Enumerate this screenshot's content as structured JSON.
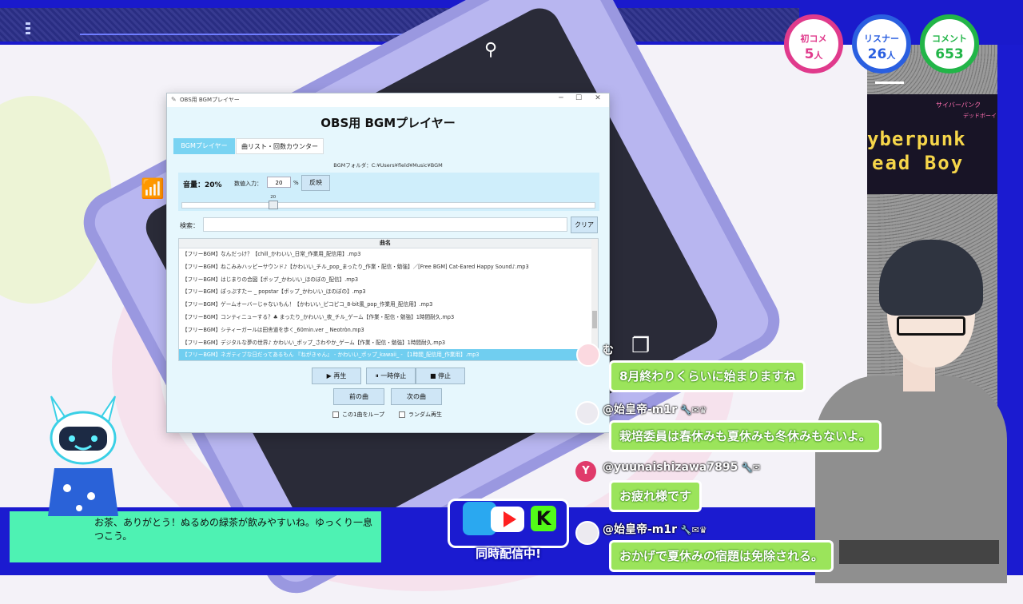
{
  "overlay": {
    "stats": [
      {
        "label": "初コメ",
        "value": "5",
        "unit": "人",
        "color": "#e03a8c"
      },
      {
        "label": "リスナー",
        "value": "26",
        "unit": "人",
        "color": "#2a5fe0"
      },
      {
        "label": "コメント",
        "value": "653",
        "unit": "",
        "color": "#22b548"
      }
    ],
    "thumbnail": {
      "line1": "yberpunk",
      "line2": "ead Boy",
      "jp1": "サイバーパンク",
      "jp2": "デッドボーイ"
    },
    "logo_text": "同時配信中!",
    "icons": [
      "search-icon",
      "wifi-icon",
      "layers-icon"
    ]
  },
  "window": {
    "title": "OBS用 BGMプレイヤー",
    "controls": [
      "─",
      "☐",
      "✕"
    ],
    "heading": "OBS用 BGMプレイヤー",
    "tabs": [
      {
        "label": "BGMプレイヤー",
        "active": true
      },
      {
        "label": "曲リスト・回数カウンター",
        "active": false
      }
    ],
    "folder": "BGMフォルダ：C:¥Users¥field¥Music¥BGM",
    "volume": {
      "label": "音量：20%",
      "input_label": "数値入力：",
      "input_value": "20",
      "unit": "%",
      "apply": "反映",
      "slider_value": "20",
      "slider_level": 0.2
    },
    "search": {
      "label": "検索：",
      "value": "",
      "clear": "クリア"
    },
    "list": {
      "header": "曲名",
      "selected_index": 8,
      "items": [
        "【フリーBGM】なんだっけ？【chill_かわいい_日常_作業用_配信用】.mp3",
        "【フリーBGM】ねこみみハッピーサウンド♪【かわいい_チル_pop_まったり_作業・配信・勉強】／[Free BGM] Cat-Eared Happy Sound♪.mp3",
        "【フリーBGM】はじまりの合図【ポップ_かわいい_ほのぼの_配信】.mp3",
        "【フリーBGM】ぽっぷすたー _ popstar【ポップ_かわいい_ほのぼの】.mp3",
        "【フリーBGM】ゲームオーバーじゃないもん！【かわいい_ピコピコ_8-bit風_pop_作業用_配信用】.mp3",
        "【フリーBGM】コンティニューする？♣ まったり_かわいい_夜_チル_ゲーム【作業・配信・勉強】1時間耐久.mp3",
        "【フリーBGM】シティーガールは田舎道を歩く_60min.ver _ Neotròn.mp3",
        "【フリーBGM】デジタルな夢の世界♪ かわいい_ポップ_さわやか_ゲーム【作業・配信・勉強】1時間耐久.mp3",
        "【フリーBGM】ネガティブな日だってあるもん 『ねがきゃん』 - かわいい_ポップ_kawaii_ - 【1時間_配信用_作業用】.mp3"
      ]
    },
    "buttons": {
      "play": "▶ 再生",
      "pause": "⏸ 一時停止",
      "stop": "■ 停止",
      "prev": "前の曲",
      "next": "次の曲"
    },
    "checkboxes": {
      "loop": "この1曲をループ",
      "random": "ランダム再生"
    }
  },
  "chat": [
    {
      "name": "む",
      "message": "8月終わりくらいに始まりますね",
      "badges": []
    },
    {
      "name": "@始皇帝-m1r",
      "message": "栽培委員は春休みも夏休みも冬休みもないよ。",
      "badges": [
        "wrench-icon",
        "mail-icon",
        "crown-icon"
      ]
    },
    {
      "name": "@yuunaishizawa7895",
      "message": "お疲れ様です",
      "badges": [
        "wrench-icon",
        "mail-icon"
      ],
      "avatar_letter": "Y"
    },
    {
      "name": "@始皇帝-m1r",
      "message": "おかげで夏休みの宿題は免除される。",
      "badges": [
        "wrench-icon",
        "mail-icon",
        "crown-icon"
      ]
    }
  ],
  "dialog": {
    "text": "お茶、ありがとう！ぬるめの緑茶が飲みやすいね。ゆっくり一息つこう。"
  }
}
